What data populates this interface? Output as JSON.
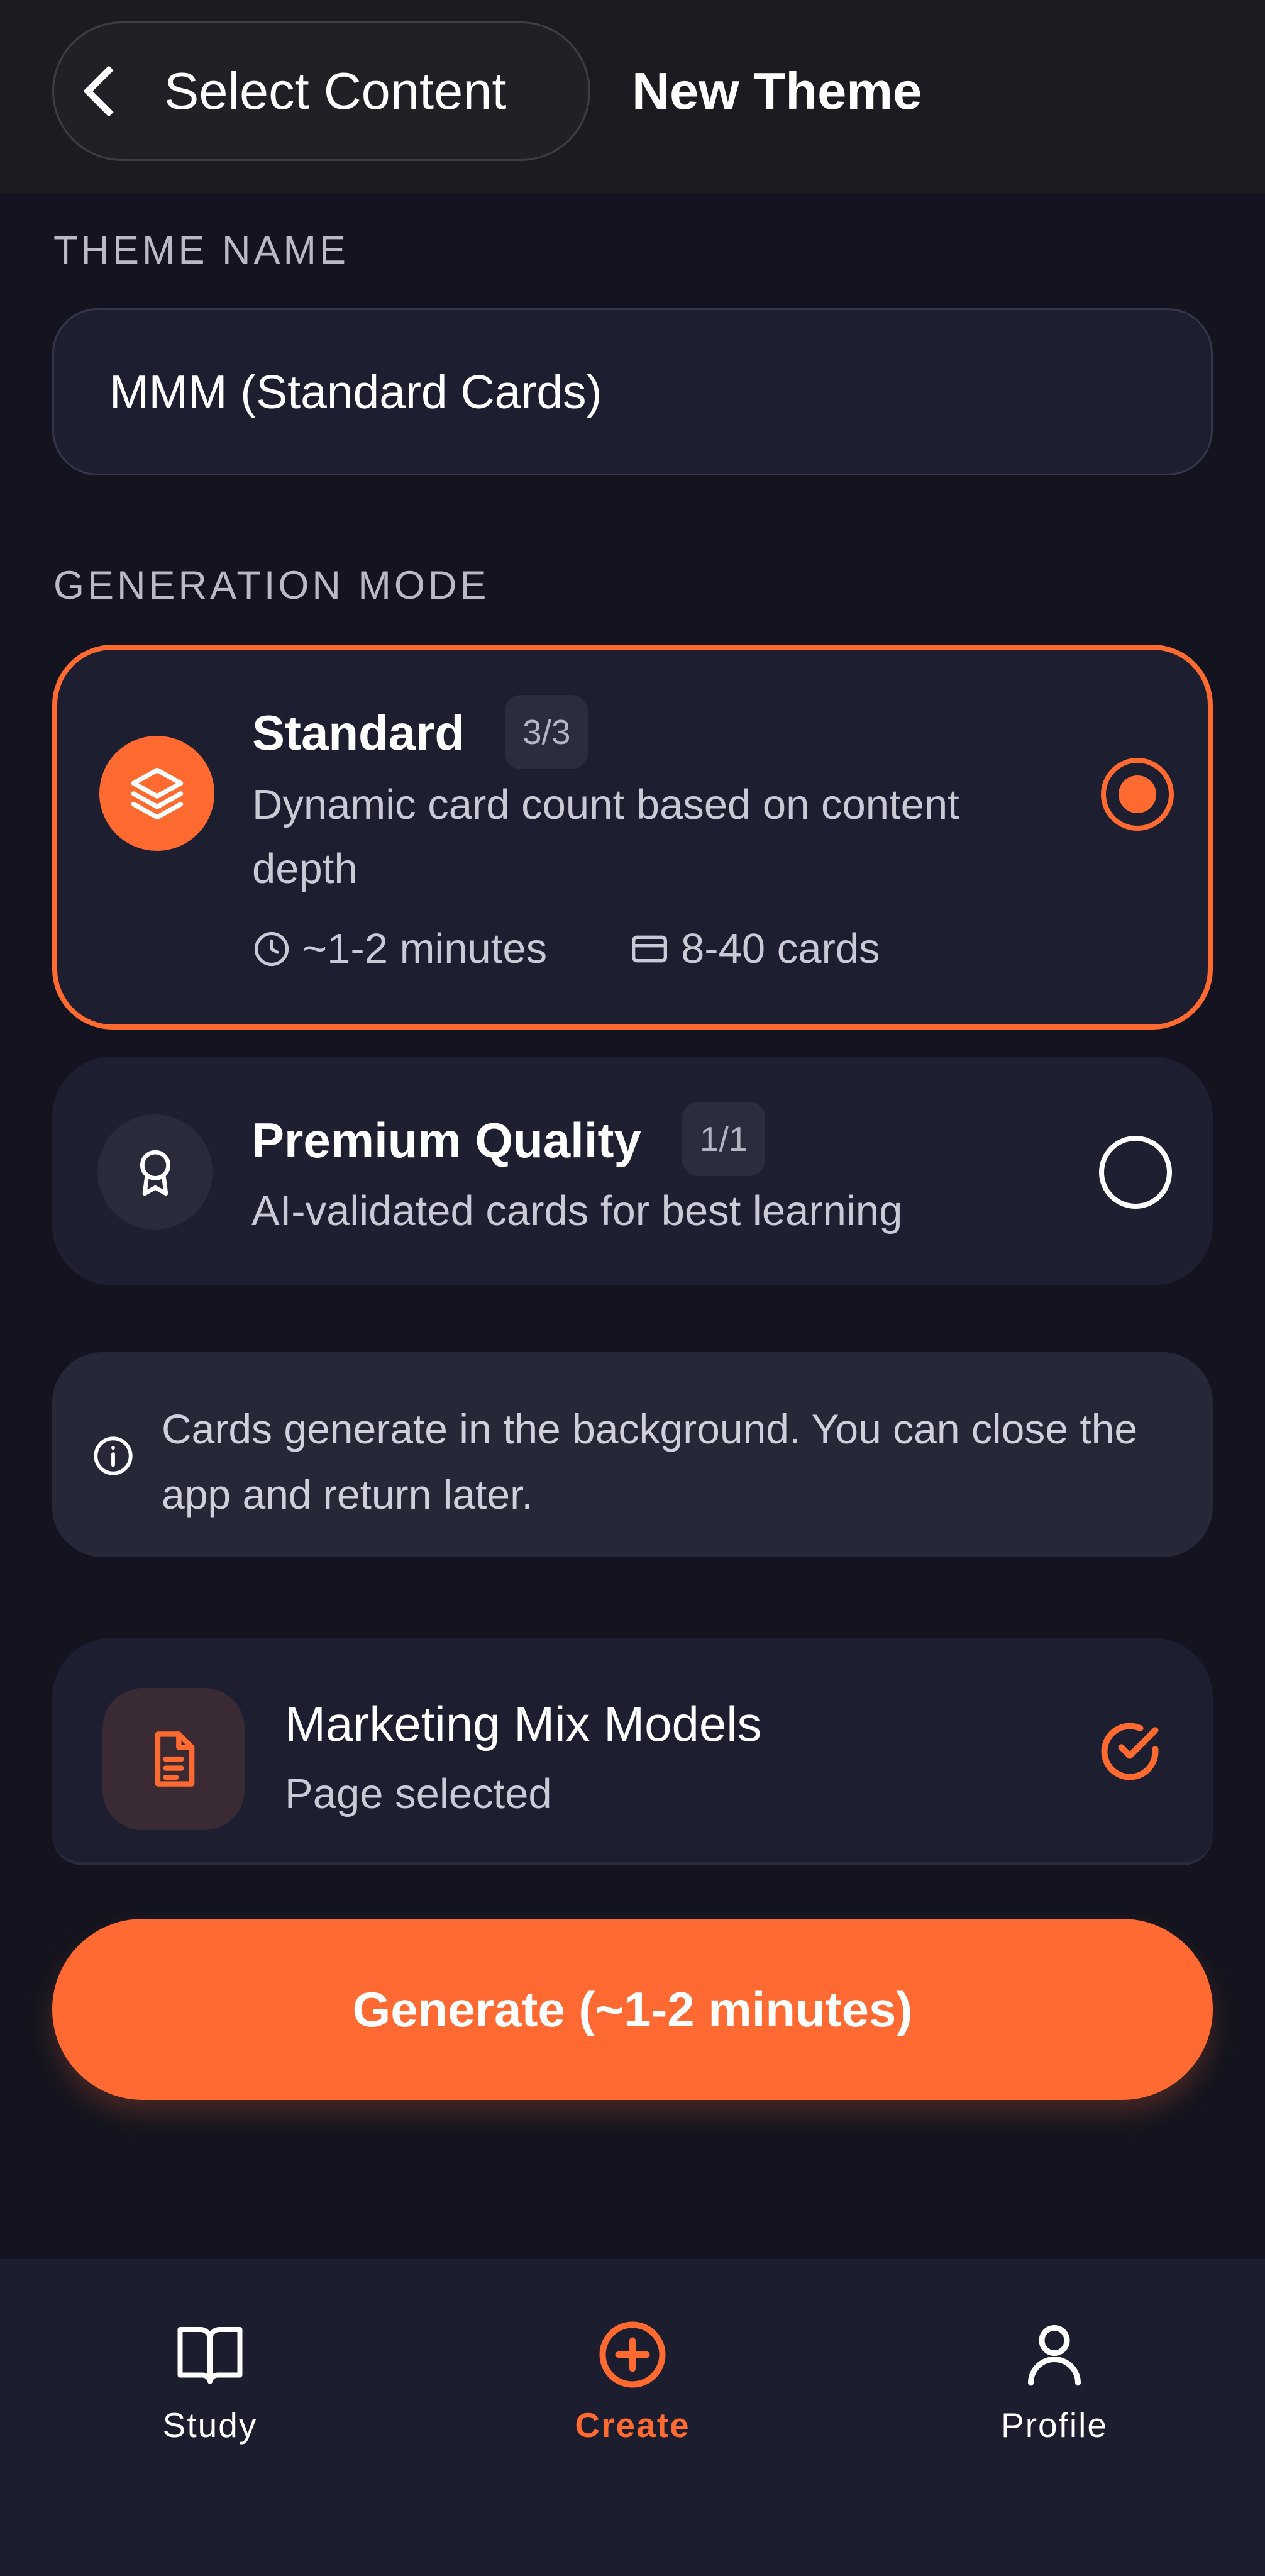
{
  "header": {
    "back_label": "Select Content",
    "title": "New Theme"
  },
  "theme_name": {
    "section_label": "THEME NAME",
    "value": "MMM (Standard Cards)"
  },
  "generation_mode": {
    "section_label": "GENERATION MODE",
    "options": [
      {
        "title": "Standard",
        "badge": "3/3",
        "description": "Dynamic card count based on content depth",
        "duration": "~1-2 minutes",
        "cards": "8-40 cards",
        "selected": true,
        "icon": "layers-icon"
      },
      {
        "title": "Premium Quality",
        "badge": "1/1",
        "description": "AI-validated cards for best learning",
        "selected": false,
        "icon": "award-ribbon-icon"
      }
    ]
  },
  "info": {
    "text": "Cards generate in the background. You can close the app and return later.",
    "icon": "info-icon"
  },
  "selected_content": {
    "title": "Marketing Mix Models",
    "subtitle": "Page selected",
    "icon": "document-icon",
    "status_icon": "check-circle-icon"
  },
  "generate_button": {
    "label": "Generate (~1-2 minutes)"
  },
  "bottom_nav": {
    "items": [
      {
        "label": "Study",
        "icon": "book-icon",
        "active": false
      },
      {
        "label": "Create",
        "icon": "plus-circle-icon",
        "active": true
      },
      {
        "label": "Profile",
        "icon": "user-icon",
        "active": false
      }
    ]
  },
  "colors": {
    "accent": "#ff6a30",
    "background": "#13141f",
    "card": "#1e1f30",
    "header": "#1b1c22"
  }
}
